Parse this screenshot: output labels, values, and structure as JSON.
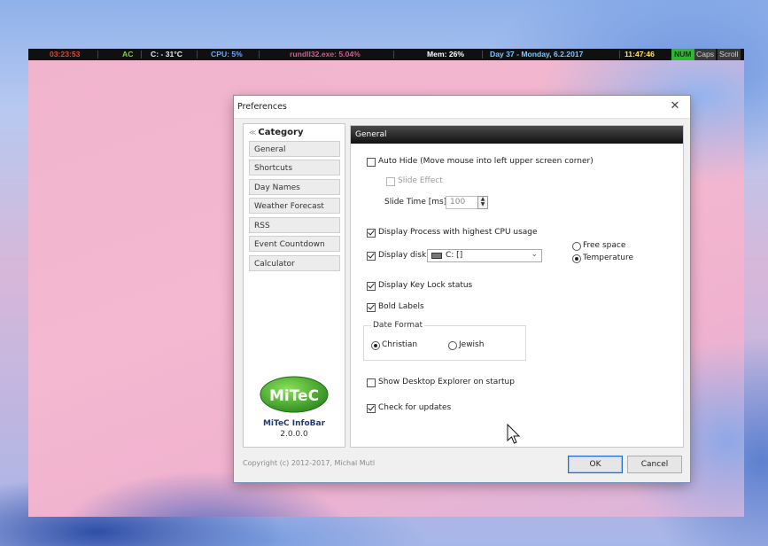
{
  "infobar": {
    "uptime": "03:23:53",
    "power": "AC",
    "cpu_temp": "C: - 31°C",
    "cpu_usage": "CPU: 5%",
    "process": "rundll32.exe: 5.04%",
    "memory": "Mem: 26%",
    "date": "Day 37 - Monday, 6.2.2017",
    "time": "11:47:46",
    "num_lock": "NUM",
    "caps_lock": "Caps",
    "scroll_lock": "Scroll",
    "colors": {
      "uptime": "#e0452a",
      "power": "#7fd13b",
      "cpu_temp": "#e8e8e8",
      "cpu_usage": "#6ea6ff",
      "process": "#d35b8e",
      "memory": "#ffffff",
      "date": "#7fc6ff",
      "time": "#ffe060",
      "num_bg": "#2fb52f"
    }
  },
  "dialog": {
    "title": "Preferences",
    "close_icon": "close-icon"
  },
  "category": {
    "header": "Category",
    "items": [
      "General",
      "Shortcuts",
      "Day Names",
      "Weather Forecast",
      "RSS",
      "Event Countdown",
      "Calculator"
    ],
    "logo_text": "MiTeC",
    "product_name": "MiTeC InfoBar",
    "version": "2.0.0.0"
  },
  "general": {
    "header": "General",
    "auto_hide": {
      "label": "Auto Hide (Move mouse into left upper screen corner)",
      "checked": false
    },
    "slide_effect": {
      "label": "Slide Effect",
      "checked": false,
      "enabled": false
    },
    "slide_time": {
      "label": "Slide Time [ms]:",
      "value": "100",
      "enabled": false
    },
    "display_process": {
      "label": "Display Process with highest CPU usage",
      "checked": true
    },
    "display_disk": {
      "label": "Display disk",
      "checked": true,
      "selected": "C: []"
    },
    "disk_mode": {
      "options": [
        "Free space",
        "Temperature"
      ],
      "selected": "Temperature"
    },
    "display_key_lock": {
      "label": "Display Key Lock status",
      "checked": true
    },
    "bold_labels": {
      "label": "Bold Labels",
      "checked": true
    },
    "date_format": {
      "title": "Date Format",
      "options": [
        "Christian",
        "Jewish"
      ],
      "selected": "Christian"
    },
    "show_desktop_explorer": {
      "label": "Show Desktop Explorer on startup",
      "checked": false
    },
    "check_updates": {
      "label": "Check for updates",
      "checked": true
    }
  },
  "footer": {
    "copyright": "Copyright (c) 2012-2017, Michal Mutl",
    "ok_label": "OK",
    "cancel_label": "Cancel"
  }
}
